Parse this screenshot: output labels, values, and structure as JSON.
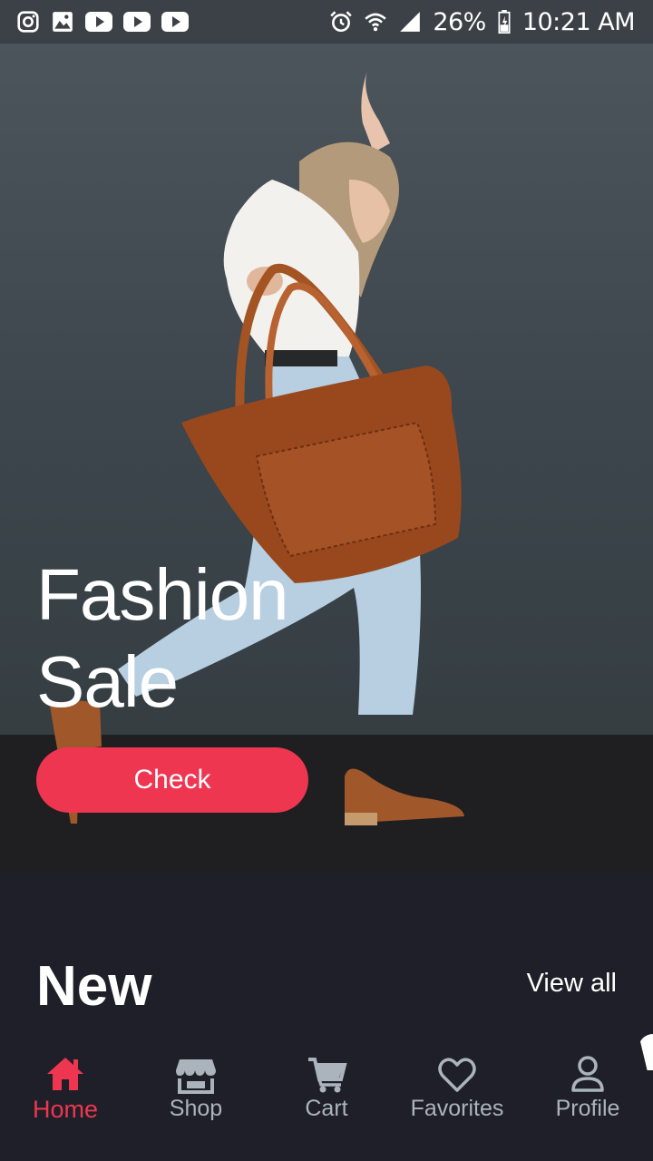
{
  "status_bar": {
    "left_icons": [
      "instagram-icon",
      "gallery-icon",
      "youtube-icon",
      "youtube-icon",
      "youtube-icon"
    ],
    "right_icons": [
      "alarm-icon",
      "wifi-icon",
      "signal-icon"
    ],
    "battery": "26%",
    "time": "10:21 AM"
  },
  "hero": {
    "title": "Fashion\nSale",
    "button_label": "Check"
  },
  "section": {
    "title": "New",
    "view_all": "View all"
  },
  "nav": {
    "items": [
      {
        "label": "Home",
        "icon": "home-icon",
        "active": true
      },
      {
        "label": "Shop",
        "icon": "shop-icon",
        "active": false
      },
      {
        "label": "Cart",
        "icon": "cart-icon",
        "active": false
      },
      {
        "label": "Favorites",
        "icon": "heart-icon",
        "active": false
      },
      {
        "label": "Profile",
        "icon": "profile-icon",
        "active": false
      }
    ]
  },
  "colors": {
    "accent": "#ef3651",
    "background": "#1e1f28",
    "inactive": "#abb4bd",
    "status_bar": "#3b4146"
  }
}
